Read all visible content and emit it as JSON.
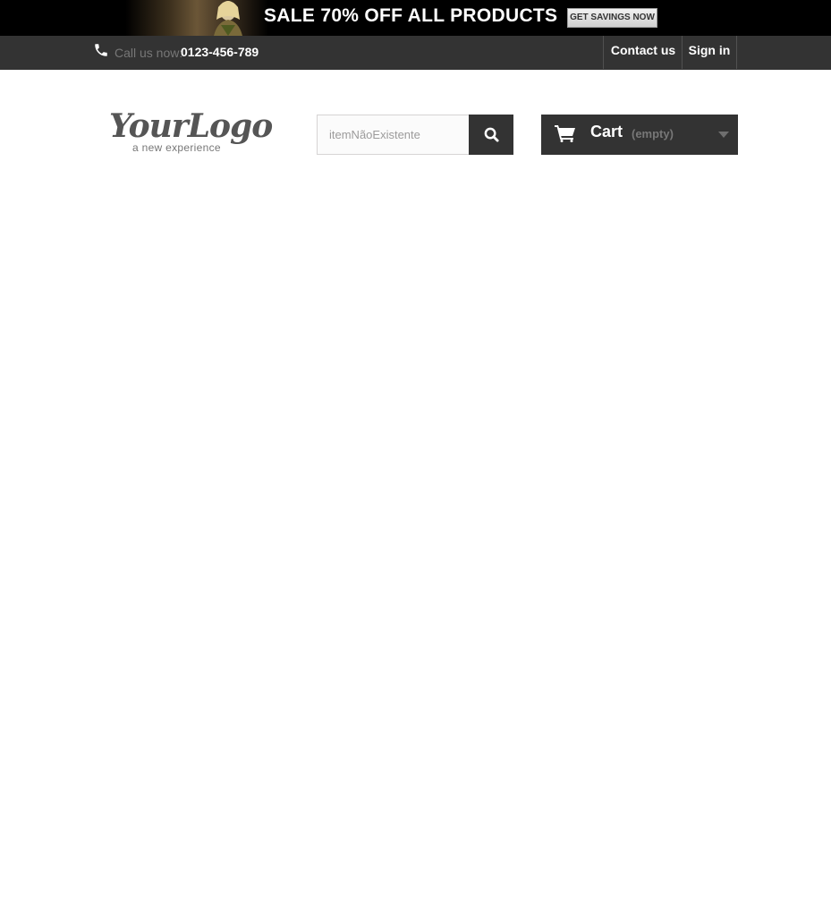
{
  "banner": {
    "headline": "SALE 70% OFF ALL PRODUCTS",
    "cta_label": "GET SAVINGS NOW"
  },
  "nav": {
    "phone_icon": "phone-icon",
    "call_label": "Call us now:",
    "call_number": "0123-456-789",
    "contact_label": "Contact us",
    "signin_label": "Sign in"
  },
  "logo": {
    "main": "YourLogo",
    "tagline": "a new experience"
  },
  "search": {
    "value": "itemNãoExistente",
    "button_icon": "search-icon"
  },
  "cart": {
    "icon": "cart-icon",
    "label": "Cart",
    "status": "(empty)"
  },
  "colors": {
    "nav_background": "#333333",
    "banner_background": "#000000",
    "page_background": "#ffffff"
  }
}
